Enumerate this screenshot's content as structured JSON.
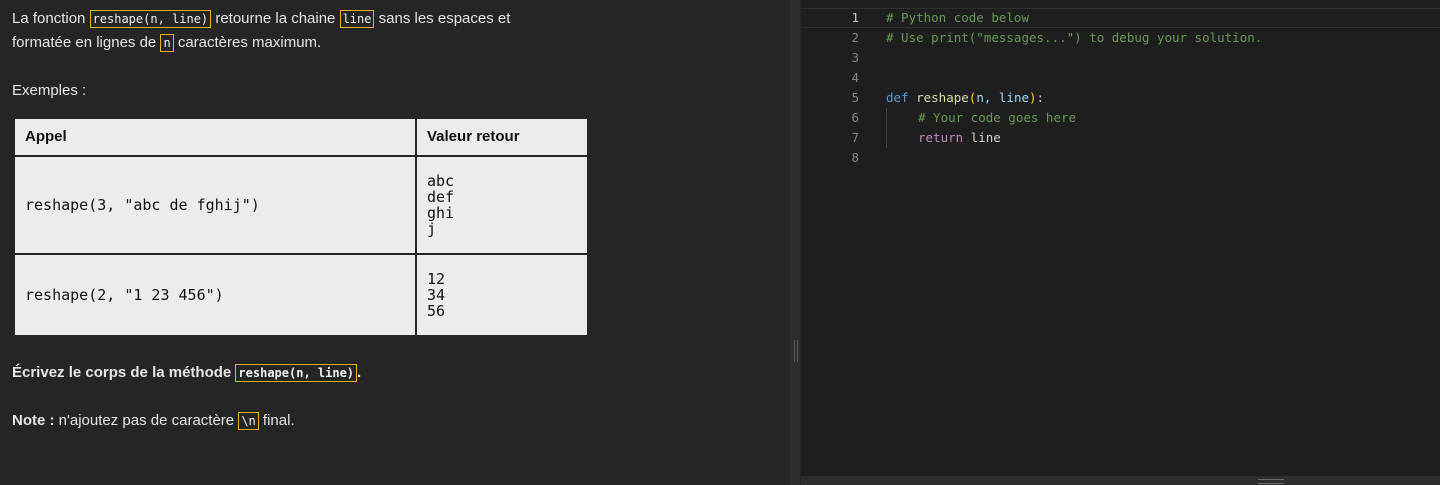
{
  "instructions": {
    "intro_1": "La fonction ",
    "intro_code_1": "reshape(n, line)",
    "intro_2": " retourne la chaine ",
    "intro_code_2": "line",
    "intro_3": " sans les espaces et",
    "intro_4": "formatée en lignes de ",
    "intro_code_3": "n",
    "intro_5": " caractères maximum.",
    "examples_label": "Exemples :",
    "table": {
      "headers": [
        "Appel",
        "Valeur retour"
      ],
      "rows": [
        {
          "call": "reshape(3, \"abc de fghij\")",
          "result": "abc\ndef\nghi\nj"
        },
        {
          "call": "reshape(2, \"1 23 456\")",
          "result": "12\n34\n56"
        }
      ]
    },
    "write_body_1": "Écrivez le corps de la méthode ",
    "write_body_code": "reshape(n, line)",
    "write_body_2": ".",
    "note_label": "Note :",
    "note_1": " n'ajoutez pas de caractère ",
    "note_code": "\\n",
    "note_2": " final."
  },
  "editor": {
    "line_numbers": [
      "1",
      "2",
      "3",
      "4",
      "5",
      "6",
      "7",
      "8"
    ],
    "line1": "# Python code below",
    "line2": "# Use print(\"messages...\") to debug your solution.",
    "line5_kw": "def",
    "line5_fn": "reshape",
    "line5_open": "(",
    "line5_params": "n, line",
    "line5_close": ")",
    "line5_colon": ":",
    "line6": "# Your code goes here",
    "line7_kw": "return",
    "line7_rest": " line"
  }
}
